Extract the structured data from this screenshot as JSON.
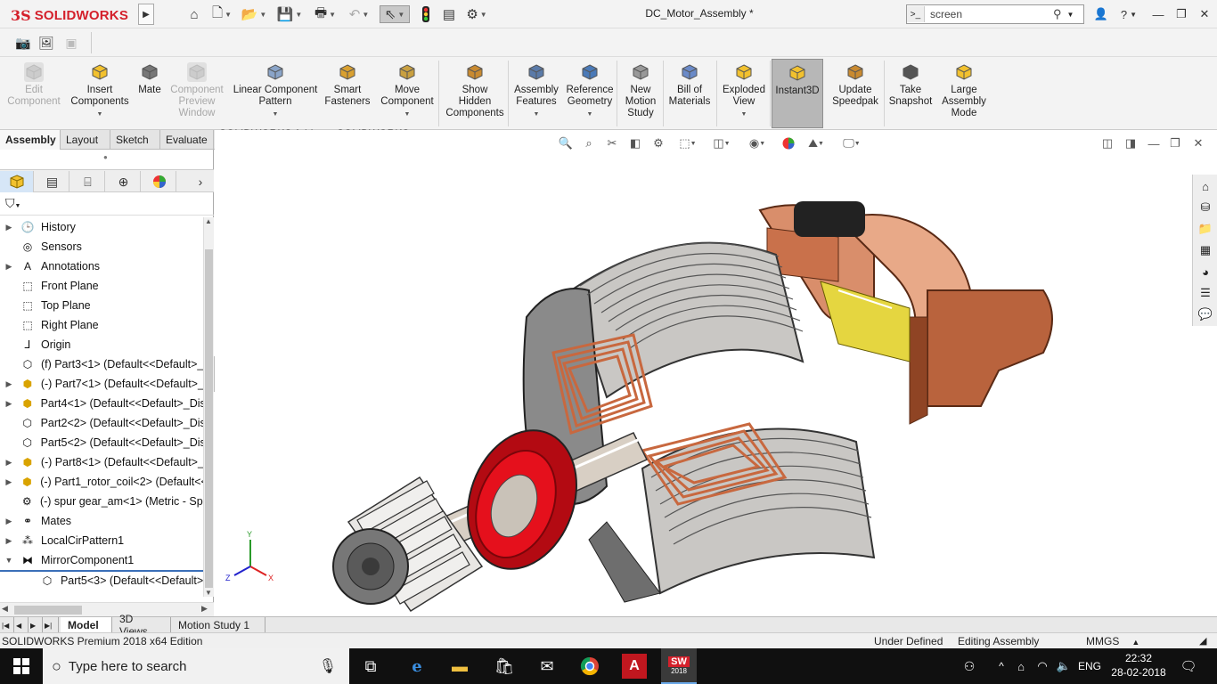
{
  "app": {
    "ds_mark": "3S",
    "brand": "SOLIDWORKS",
    "doc_title": "DC_Motor_Assembly *"
  },
  "search": {
    "value": "screen",
    "placeholder": "screen"
  },
  "title_controls": {
    "help": "?",
    "minimize": "—",
    "restore": "❐",
    "close": "✕"
  },
  "commands": [
    {
      "label_lines": [
        "Edit",
        "Component"
      ],
      "icon": "edit-component-icon",
      "disabled": true
    },
    {
      "label_lines": [
        "Insert",
        "Components"
      ],
      "icon": "insert-components-icon",
      "disabled": false,
      "dropdown": true
    },
    {
      "label_lines": [
        "Mate"
      ],
      "icon": "mate-icon",
      "disabled": false
    },
    {
      "label_lines": [
        "Component",
        "Preview",
        "Window"
      ],
      "icon": "component-preview-icon",
      "disabled": true
    },
    {
      "label_lines": [
        "Linear Component",
        "Pattern"
      ],
      "icon": "linear-pattern-icon",
      "disabled": false,
      "dropdown": true
    },
    {
      "label_lines": [
        "Smart",
        "Fasteners"
      ],
      "icon": "smart-fasteners-icon",
      "disabled": false
    },
    {
      "label_lines": [
        "Move",
        "Component"
      ],
      "icon": "move-component-icon",
      "disabled": false,
      "dropdown": true
    },
    {
      "label_lines": [
        "Show",
        "Hidden",
        "Components"
      ],
      "icon": "show-hidden-icon",
      "disabled": false
    },
    {
      "label_lines": [
        "Assembly",
        "Features"
      ],
      "icon": "assembly-features-icon",
      "disabled": false,
      "dropdown": true
    },
    {
      "label_lines": [
        "Reference",
        "Geometry"
      ],
      "icon": "reference-geometry-icon",
      "disabled": false,
      "dropdown": true
    },
    {
      "label_lines": [
        "New",
        "Motion",
        "Study"
      ],
      "icon": "motion-study-icon",
      "disabled": false
    },
    {
      "label_lines": [
        "Bill of",
        "Materials"
      ],
      "icon": "bom-icon",
      "disabled": false
    },
    {
      "label_lines": [
        "Exploded",
        "View"
      ],
      "icon": "exploded-view-icon",
      "disabled": false,
      "dropdown": true
    },
    {
      "label_lines": [
        "Instant3D"
      ],
      "icon": "instant3d-icon",
      "disabled": false,
      "active": true
    },
    {
      "label_lines": [
        "Update",
        "Speedpak"
      ],
      "icon": "speedpak-icon",
      "disabled": false
    },
    {
      "label_lines": [
        "Take",
        "Snapshot"
      ],
      "icon": "snapshot-icon",
      "disabled": false
    },
    {
      "label_lines": [
        "Large",
        "Assembly",
        "Mode"
      ],
      "icon": "large-assembly-icon",
      "disabled": false
    }
  ],
  "tabs": [
    "Assembly",
    "Layout",
    "Sketch",
    "Evaluate",
    "SOLIDWORKS Add-Ins",
    "SOLIDWORKS MBD"
  ],
  "active_tab": "Assembly",
  "tree": [
    {
      "label": "History",
      "expand": "▶",
      "icon": "history-icon"
    },
    {
      "label": "Sensors",
      "expand": "",
      "icon": "sensors-icon"
    },
    {
      "label": "Annotations",
      "expand": "▶",
      "icon": "annotations-icon"
    },
    {
      "label": "Front Plane",
      "expand": "",
      "icon": "plane-icon"
    },
    {
      "label": "Top Plane",
      "expand": "",
      "icon": "plane-icon"
    },
    {
      "label": "Right Plane",
      "expand": "",
      "icon": "plane-icon"
    },
    {
      "label": "Origin",
      "expand": "",
      "icon": "origin-icon"
    },
    {
      "label": "(f) Part3<1> (Default<<Default>_",
      "expand": "",
      "icon": "part-icon"
    },
    {
      "label": "(-) Part7<1> (Default<<Default>_",
      "expand": "▶",
      "icon": "subassembly-icon"
    },
    {
      "label": "Part4<1> (Default<<Default>_Dis",
      "expand": "▶",
      "icon": "subassembly-icon"
    },
    {
      "label": "Part2<2> (Default<<Default>_Dis",
      "expand": "",
      "icon": "part-icon"
    },
    {
      "label": "Part5<2> (Default<<Default>_Dis",
      "expand": "",
      "icon": "part-icon"
    },
    {
      "label": "(-) Part8<1> (Default<<Default>_",
      "expand": "▶",
      "icon": "subassembly-icon"
    },
    {
      "label": "(-) Part1_rotor_coil<2> (Default<<",
      "expand": "▶",
      "icon": "subassembly-icon"
    },
    {
      "label": "(-) spur gear_am<1> (Metric - Spu",
      "expand": "",
      "icon": "gear-icon"
    },
    {
      "label": "Mates",
      "expand": "▶",
      "icon": "mates-icon"
    },
    {
      "label": "LocalCirPattern1",
      "expand": "▶",
      "icon": "pattern-icon"
    },
    {
      "label": "MirrorComponent1",
      "expand": "▼",
      "icon": "mirror-icon"
    },
    {
      "label": "Part5<3> (Default<<Default>",
      "expand": "",
      "icon": "part-icon",
      "indent": true
    }
  ],
  "bottom_tabs": [
    "Model",
    "3D Views",
    "Motion Study 1"
  ],
  "active_bottom_tab": "Model",
  "status": {
    "edition": "SOLIDWORKS Premium 2018 x64 Edition",
    "state": "Under Defined",
    "mode": "Editing Assembly",
    "units": "MMGS",
    "units_arrow": "▲"
  },
  "taskbar": {
    "search_placeholder": "Type here to search",
    "lang": "ENG",
    "time": "22:32",
    "date": "28-02-2018",
    "sw_label": "2018"
  },
  "axes": {
    "x": "X",
    "y": "Y",
    "z": "Z"
  },
  "colors": {
    "brand_red": "#d4202b",
    "copper": "#c8683f",
    "stator_gray": "#8a8a8a",
    "bearing_red": "#d9101a",
    "yellow_part": "#f0e040"
  }
}
